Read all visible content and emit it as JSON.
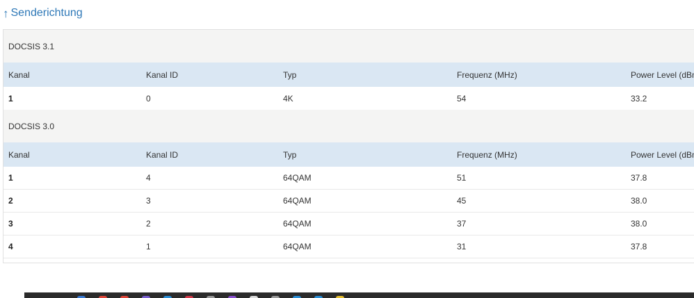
{
  "heading": {
    "arrow": "↑",
    "title": "Senderichtung"
  },
  "columns": [
    "Kanal",
    "Kanal ID",
    "Typ",
    "Frequenz (MHz)",
    "Power Level (dBm"
  ],
  "sections": [
    {
      "title": "DOCSIS 3.1",
      "rows": [
        [
          "1",
          "0",
          "4K",
          "54",
          "33.2"
        ]
      ]
    },
    {
      "title": "DOCSIS 3.0",
      "rows": [
        [
          "1",
          "4",
          "64QAM",
          "51",
          "37.8"
        ],
        [
          "2",
          "3",
          "64QAM",
          "45",
          "38.0"
        ],
        [
          "3",
          "2",
          "64QAM",
          "37",
          "38.0"
        ],
        [
          "4",
          "1",
          "64QAM",
          "31",
          "37.8"
        ]
      ]
    }
  ],
  "taskbar_icons": [
    {
      "name": "edge-icon",
      "color": "#3a7bd5"
    },
    {
      "name": "chrome-icon",
      "color": "#e0463a"
    },
    {
      "name": "firefox-icon",
      "color": "#e0463a"
    },
    {
      "name": "app-icon",
      "color": "#7a5fd0"
    },
    {
      "name": "app-icon",
      "color": "#2a8fd8"
    },
    {
      "name": "app-icon",
      "color": "#d63a4a"
    },
    {
      "name": "app-icon",
      "color": "#9b9b9b"
    },
    {
      "name": "app-icon",
      "color": "#8a4fd0"
    },
    {
      "name": "app-icon",
      "color": "#dddddd"
    },
    {
      "name": "app-icon",
      "color": "#9b9b9b"
    },
    {
      "name": "app-icon",
      "color": "#2a8fd8"
    },
    {
      "name": "app-icon",
      "color": "#2a8fd8"
    },
    {
      "name": "app-icon",
      "color": "#e8c030"
    }
  ]
}
